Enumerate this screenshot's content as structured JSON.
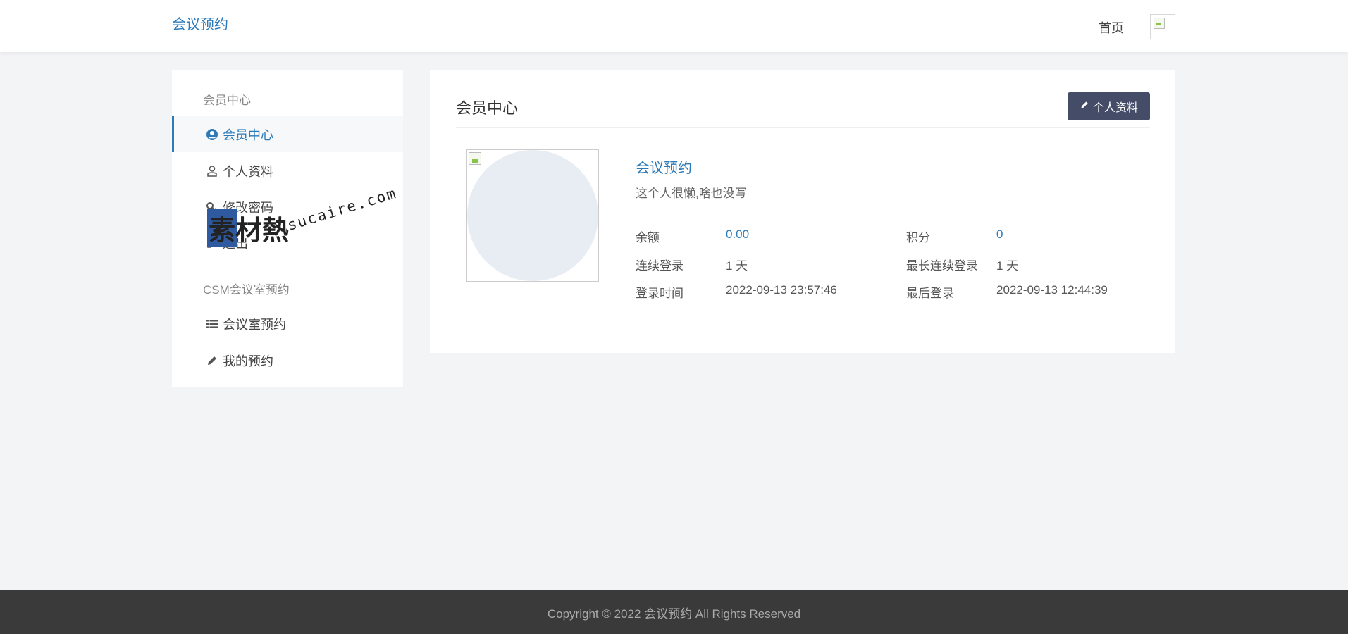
{
  "header": {
    "brand": "会议预约",
    "nav_home": "首页"
  },
  "sidebar": {
    "section1_title": "会员中心",
    "section1_items": [
      {
        "label": "会员中心",
        "icon": "user-circle-icon",
        "active": true
      },
      {
        "label": "个人资料",
        "icon": "user-icon"
      },
      {
        "label": "修改密码",
        "icon": "key-icon"
      },
      {
        "label": "退出",
        "icon": "sign-out-icon"
      }
    ],
    "section2_title": "CSM会议室预约",
    "section2_items": [
      {
        "label": "会议室预约",
        "icon": "list-icon"
      },
      {
        "label": "我的预约",
        "icon": "pencil-icon"
      }
    ]
  },
  "watermark": {
    "cn": "素材熱",
    "en": "sucaire.com"
  },
  "main": {
    "title": "会员中心",
    "profile_button": "个人资料",
    "username": "会议预约",
    "bio": "这个人很懒,啥也没写",
    "stats": {
      "balance_label": "余额",
      "balance_value": "0.00",
      "points_label": "积分",
      "points_value": "0",
      "streak_label": "连续登录",
      "streak_value": "1 天",
      "max_streak_label": "最长连续登录",
      "max_streak_value": "1 天",
      "login_time_label": "登录时间",
      "login_time_value": "2022-09-13 23:57:46",
      "last_login_label": "最后登录",
      "last_login_value": "2022-09-13 12:44:39"
    }
  },
  "footer": {
    "copyright": "Copyright © 2022 会议预约 All Rights Reserved"
  },
  "colors": {
    "accent": "#2c7ab8",
    "button_bg": "#444c68",
    "footer_bg": "#3a3a3a",
    "page_bg": "#f3f4f6"
  }
}
